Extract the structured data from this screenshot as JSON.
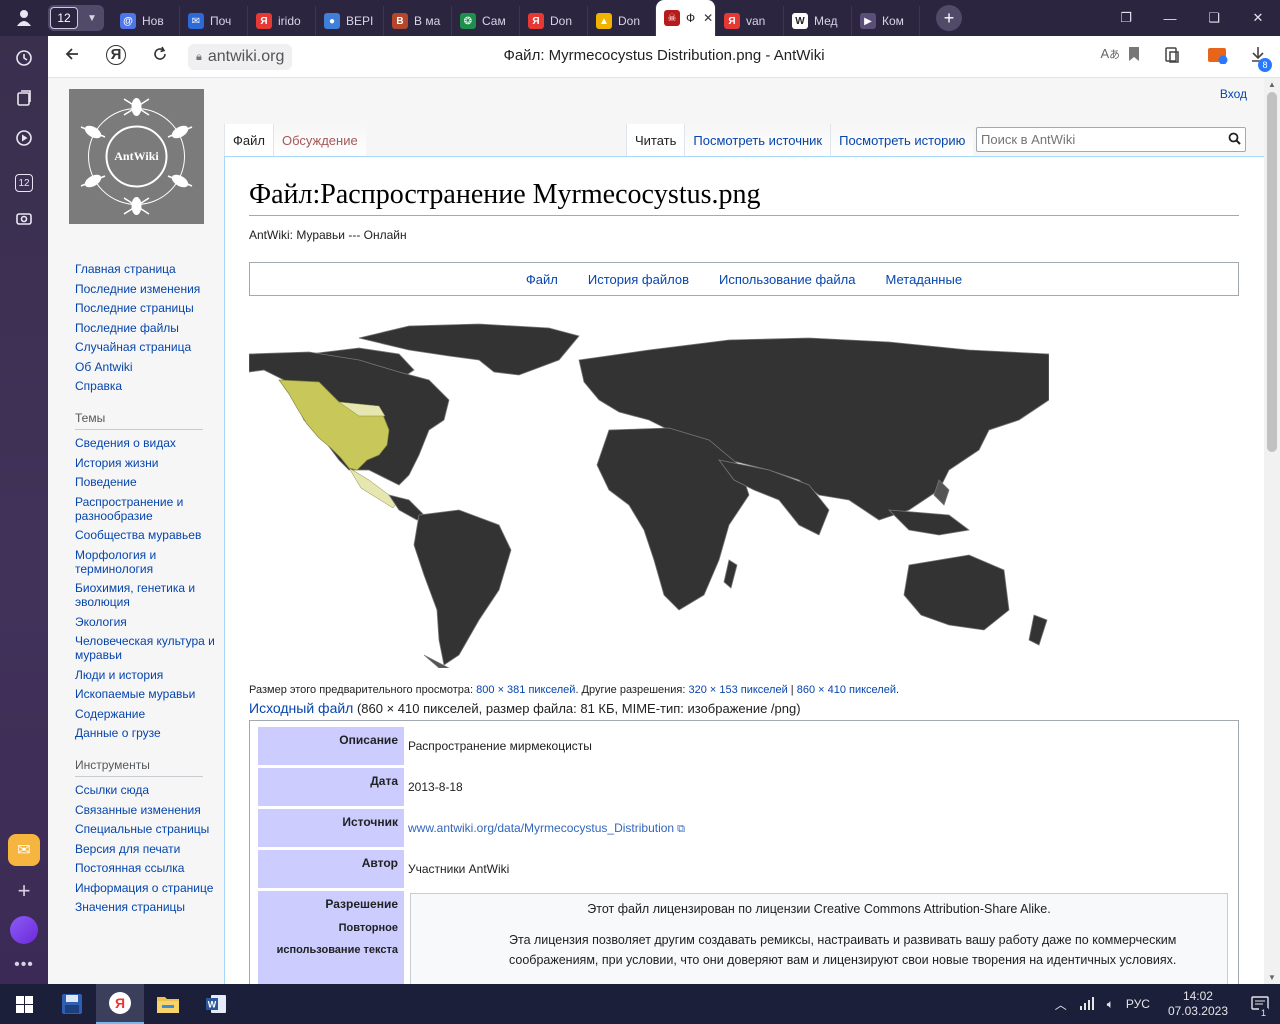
{
  "browser": {
    "tab_count": "12",
    "tabs": [
      {
        "label": "Нов",
        "fav_color": "#4e76e8",
        "fav_glyph": "@"
      },
      {
        "label": "Поч",
        "fav_color": "#2d6ad8",
        "fav_glyph": "✉"
      },
      {
        "label": "irido",
        "fav_color": "#e53935",
        "fav_glyph": "Я"
      },
      {
        "label": "ВЕРІ",
        "fav_color": "#3f7fd8",
        "fav_glyph": "●"
      },
      {
        "label": "В ма",
        "fav_color": "#b2472b",
        "fav_glyph": "В"
      },
      {
        "label": "Сам",
        "fav_color": "#1f8f4e",
        "fav_glyph": "❂"
      },
      {
        "label": "Don",
        "fav_color": "#e53935",
        "fav_glyph": "Я"
      },
      {
        "label": "Don",
        "fav_color": "#f0b400",
        "fav_glyph": "▲"
      },
      {
        "label": "Ф",
        "fav_color": "#b71c1c",
        "fav_glyph": "☠",
        "active": true
      },
      {
        "label": "van",
        "fav_color": "#e53935",
        "fav_glyph": "Я"
      },
      {
        "label": "Мед",
        "fav_color": "#ffffff",
        "fav_glyph": "W"
      },
      {
        "label": "Ком",
        "fav_color": "#5a4f78",
        "fav_glyph": "▶"
      }
    ],
    "host": "antwiki.org",
    "page_title": "Файл: Myrmecocystus Distribution.png - AntWiki",
    "download_badge": "8"
  },
  "wiki": {
    "login": "Вход",
    "tabs_left": [
      {
        "label": "Файл",
        "selected": true
      },
      {
        "label": "Обсуждение",
        "new": true
      }
    ],
    "tabs_right": [
      {
        "label": "Читать",
        "selected": true
      },
      {
        "label": "Посмотреть источник"
      },
      {
        "label": "Посмотреть историю"
      }
    ],
    "search_placeholder": "Поиск в AntWiki",
    "logo_text": "AntWiki",
    "sidebar": {
      "main_links": [
        "Главная страница",
        "Последние изменения",
        "Последние страницы",
        "Последние файлы",
        "Случайная страница",
        "Об Antwiki",
        "Справка"
      ],
      "topics_heading": "Темы",
      "topics": [
        "Сведения о видах",
        "История жизни",
        "Поведение",
        "Распространение и разнообразие",
        "Сообщества муравьев",
        "Морфология и терминология",
        "Биохимия, генетика и эволюция",
        "Экология",
        "Человеческая культура и муравьи",
        "Люди и история",
        "Ископаемые муравьи",
        "Содержание",
        "Данные о грузе"
      ],
      "tools_heading": "Инструменты",
      "tools": [
        "Ссылки сюда",
        "Связанные изменения",
        "Специальные страницы",
        "Версия для печати",
        "Постоянная ссылка",
        "Информация о странице",
        "Значения страницы"
      ]
    },
    "title": "Файл:Распространение Myrmecocystus.png",
    "tagline": "AntWiki: Муравьи --- Онлайн",
    "file_toc": [
      "Файл",
      "История файлов",
      "Использование файла",
      "Метаданные"
    ],
    "preview": {
      "prefix": "Размер этого предварительного просмотра: ",
      "size": "800 × 381 пикселей",
      "other_label": ". Другие разрешения: ",
      "res1": "320 × 153 пикселей",
      "sep": " | ",
      "res2": "860 × 410 пикселей",
      "end": "."
    },
    "full": {
      "link": "Исходный файл",
      "details": " (860 × 410 пикселей, размер файла: 81 КБ, MIME-тип: изображение /png)"
    },
    "info": [
      {
        "label": "Описание",
        "value": "Распространение мирмекоцисты"
      },
      {
        "label": "Дата",
        "value": "2013-8-18"
      },
      {
        "label": "Источник",
        "value": "www.antwiki.org/data/Myrmecocystus_Distribution",
        "link": true
      },
      {
        "label": "Автор",
        "value": "Участники AntWiki"
      }
    ],
    "license": {
      "label": "Разрешение",
      "sublabel": "Повторное использование текста",
      "head": "Этот файл лицензирован по лицензии Creative Commons Attribution-Share Alike.",
      "body": "Эта лицензия позволяет другим создавать ремиксы, настраивать и развивать вашу работу даже по коммерческим соображениям, при условии, что они доверяют вам и лицензируют свои новые творения на идентичных условиях."
    }
  },
  "taskbar": {
    "lang": "РУС",
    "time": "14:02",
    "date": "07.03.2023",
    "notif_count": "1"
  },
  "colors": {
    "link": "#0645ad",
    "map_land": "#333333",
    "map_range": "#c8c85a",
    "label_bg": "#ccccff"
  }
}
